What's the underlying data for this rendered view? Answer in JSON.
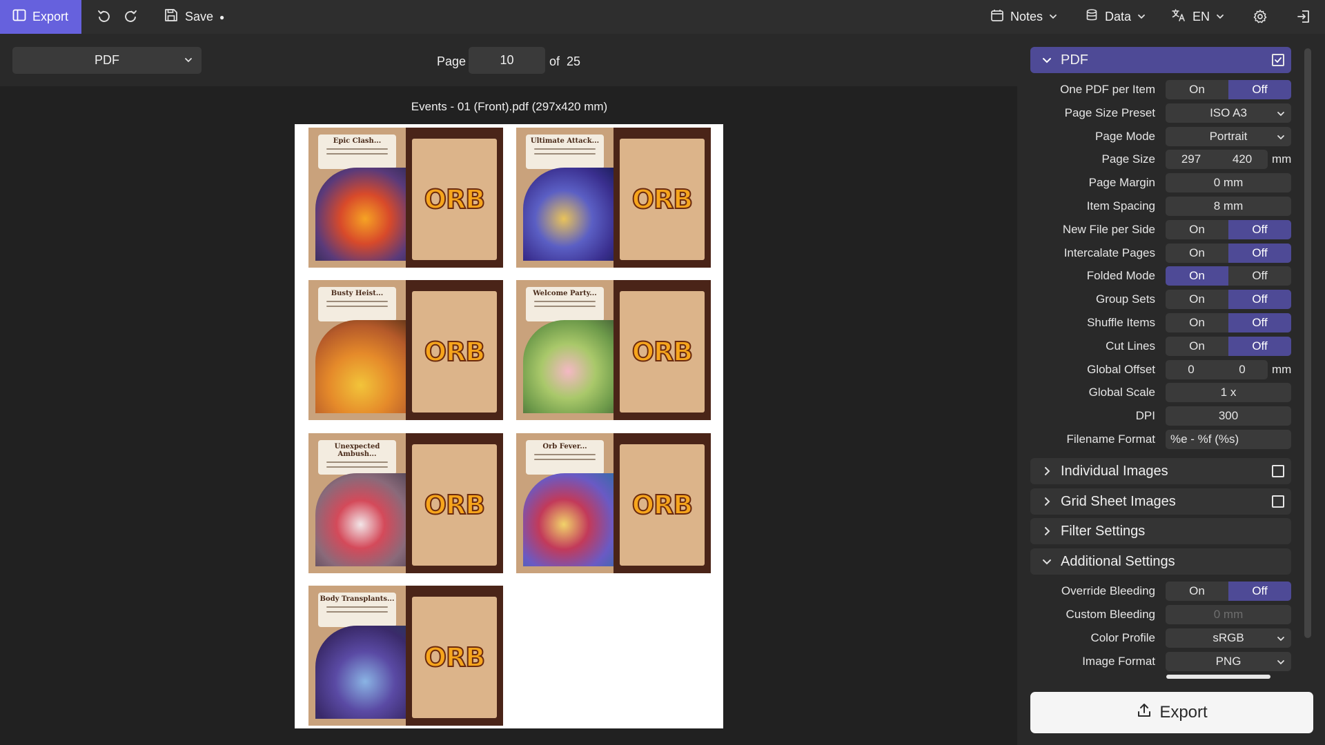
{
  "topbar": {
    "export_label": "Export",
    "save_label": "Save",
    "save_dot": "●",
    "notes_label": "Notes",
    "data_label": "Data",
    "lang_label": "EN"
  },
  "toolbar": {
    "format_value": "PDF",
    "page_label": "Page",
    "page_value": "10",
    "of_label": "of",
    "page_total": "25"
  },
  "preview": {
    "file_title": "Events - 01 (Front).pdf (297x420 mm)",
    "back_text": "ORB",
    "cards": [
      {
        "title": "Epic Clash..."
      },
      {
        "title": "Ultimate Attack..."
      },
      {
        "title": "Busty Heist..."
      },
      {
        "title": "Welcome Party..."
      },
      {
        "title": "Unexpected Ambush..."
      },
      {
        "title": "Orb Fever..."
      },
      {
        "title": "Body Transplants..."
      }
    ]
  },
  "panel": {
    "pdf_header": "PDF",
    "on": "On",
    "off": "Off",
    "mm": "mm",
    "labels": {
      "one_pdf": "One PDF per Item",
      "page_size_preset": "Page Size Preset",
      "page_mode": "Page Mode",
      "page_size": "Page Size",
      "page_margin": "Page Margin",
      "item_spacing": "Item Spacing",
      "new_file": "New File per Side",
      "intercalate": "Intercalate Pages",
      "folded": "Folded Mode",
      "group_sets": "Group Sets",
      "shuffle": "Shuffle Items",
      "cut_lines": "Cut Lines",
      "global_offset": "Global Offset",
      "global_scale": "Global Scale",
      "dpi": "DPI",
      "filename_format": "Filename Format",
      "override_bleeding": "Override Bleeding",
      "custom_bleeding": "Custom Bleeding",
      "color_profile": "Color Profile",
      "image_format": "Image Format"
    },
    "values": {
      "page_size_preset": "ISO A3",
      "page_mode": "Portrait",
      "page_w": "297",
      "page_h": "420",
      "page_margin": "0 mm",
      "item_spacing": "8 mm",
      "offset_x": "0",
      "offset_y": "0",
      "global_scale": "1 x",
      "dpi": "300",
      "filename_format": "%e - %f (%s)",
      "custom_bleeding": "0 mm",
      "color_profile": "sRGB",
      "image_format": "PNG"
    },
    "sections": {
      "individual_images": "Individual Images",
      "grid_sheet_images": "Grid Sheet Images",
      "filter_settings": "Filter Settings",
      "additional_settings": "Additional Settings"
    },
    "export_button": "Export"
  }
}
